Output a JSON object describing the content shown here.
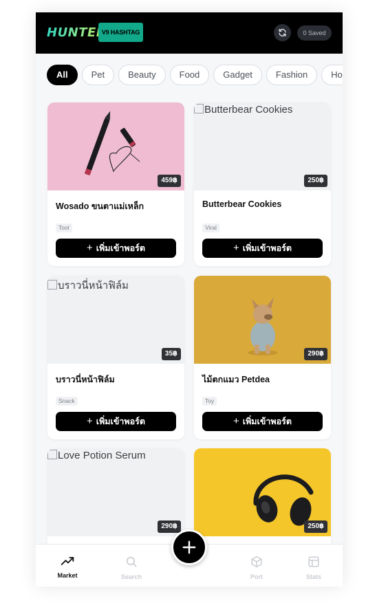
{
  "header": {
    "logo": "HUNTER",
    "version_badge": "V9 HASHTAG",
    "saved_label": "0 Saved"
  },
  "categories": [
    "All",
    "Pet",
    "Beauty",
    "Food",
    "Gadget",
    "Fashion",
    "Hor"
  ],
  "active_category": "All",
  "add_label": "เพิ่มเข้าพอร์ต",
  "products": [
    {
      "name": "Wosado ขนตาแม่เหล็ก",
      "price": "459฿",
      "tag": "Tool",
      "image_alt": ""
    },
    {
      "name": "Butterbear Cookies",
      "price": "250฿",
      "tag": "Viral",
      "image_alt": "Butterbear Cookies"
    },
    {
      "name": "บราวนี่หน้าฟิล์ม",
      "price": "35฿",
      "tag": "Snack",
      "image_alt": "บราวนี่หน้าฟิล์ม"
    },
    {
      "name": "ไม้ตกแมว Petdea",
      "price": "290฿",
      "tag": "Toy",
      "image_alt": ""
    },
    {
      "name": "",
      "price": "290฿",
      "tag": "",
      "image_alt": "Love Potion Serum"
    },
    {
      "name": "",
      "price": "250฿",
      "tag": "",
      "image_alt": ""
    }
  ],
  "nav": {
    "market": "Market",
    "search": "Search",
    "port": "Port",
    "stats": "Stats"
  },
  "colors": {
    "accent": "#12a98a",
    "header_bg": "#000000",
    "button_bg": "#000000"
  }
}
